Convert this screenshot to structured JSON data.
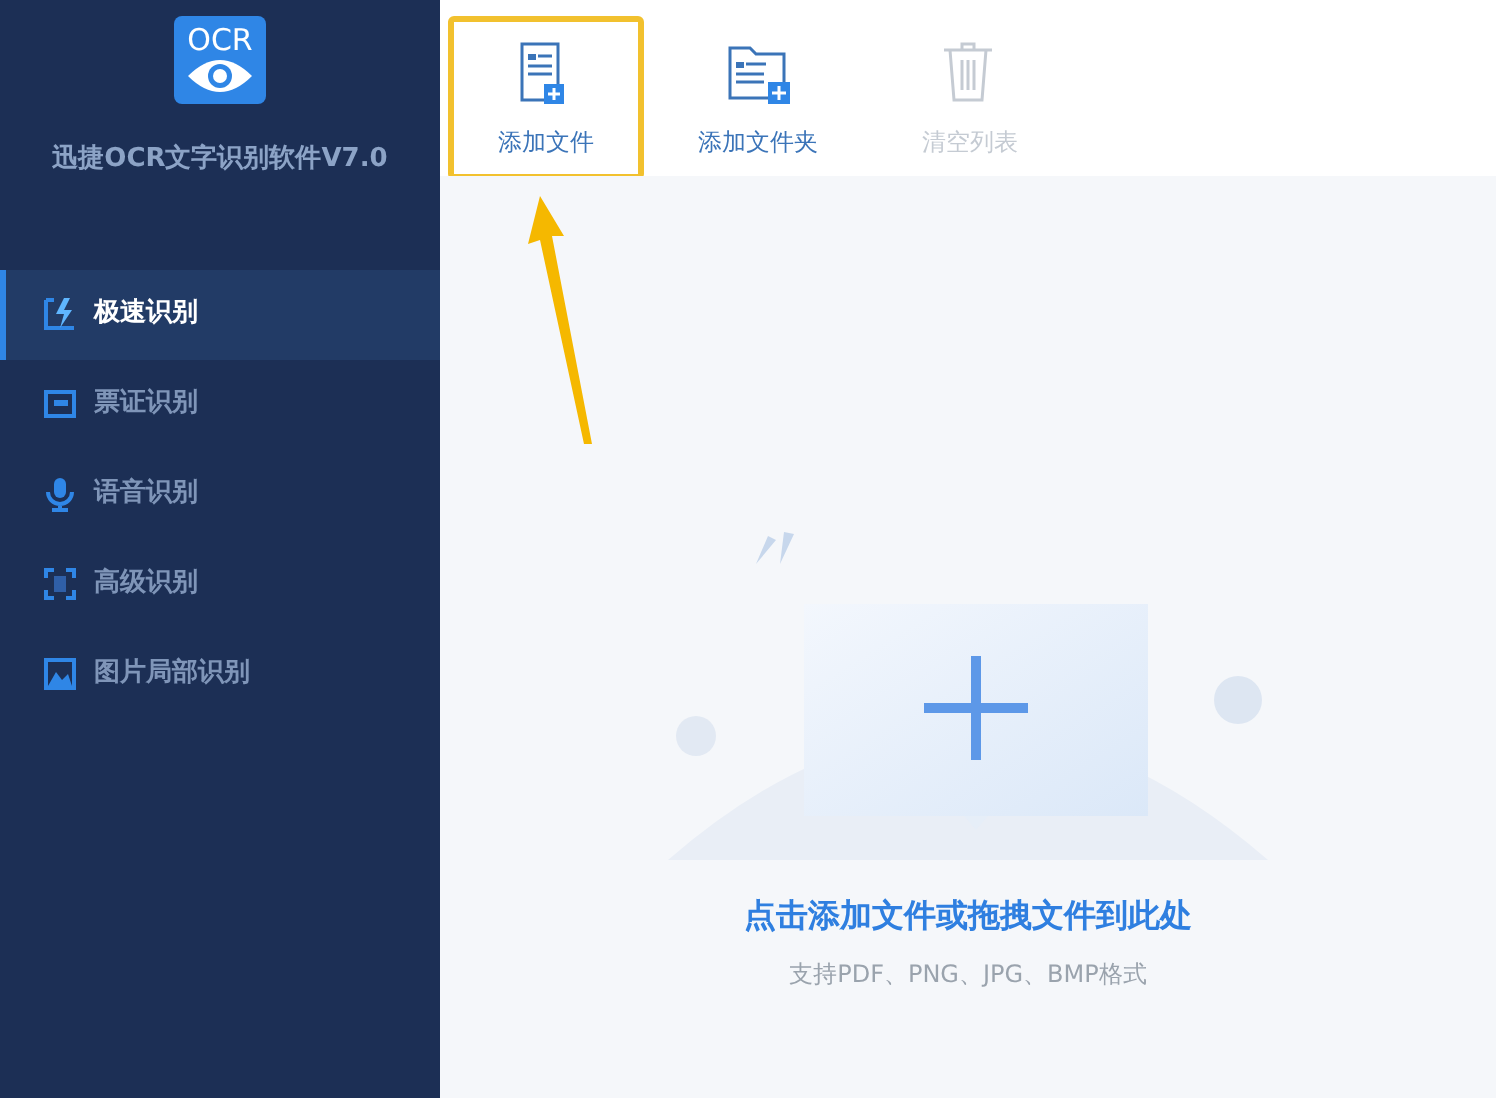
{
  "app": {
    "logo_text": "OCR",
    "title": "迅捷OCR文字识别软件V7.0"
  },
  "sidebar": {
    "items": [
      {
        "label": "极速识别",
        "kind": "fast",
        "selected": true
      },
      {
        "label": "票证识别",
        "kind": "ticket",
        "selected": false
      },
      {
        "label": "语音识别",
        "kind": "voice",
        "selected": false
      },
      {
        "label": "高级识别",
        "kind": "advanced",
        "selected": false
      },
      {
        "label": "图片局部识别",
        "kind": "partial",
        "selected": false
      }
    ]
  },
  "toolbar": [
    {
      "label": "添加文件",
      "kind": "file",
      "disabled": false,
      "highlighted": true
    },
    {
      "label": "添加文件夹",
      "kind": "folder",
      "disabled": false,
      "highlighted": false
    },
    {
      "label": "清空列表",
      "kind": "trash",
      "disabled": true,
      "highlighted": false
    }
  ],
  "drop_zone": {
    "heading": "点击添加文件或拖拽文件到此处",
    "hint": "支持PDF、PNG、JPG、BMP格式"
  }
}
